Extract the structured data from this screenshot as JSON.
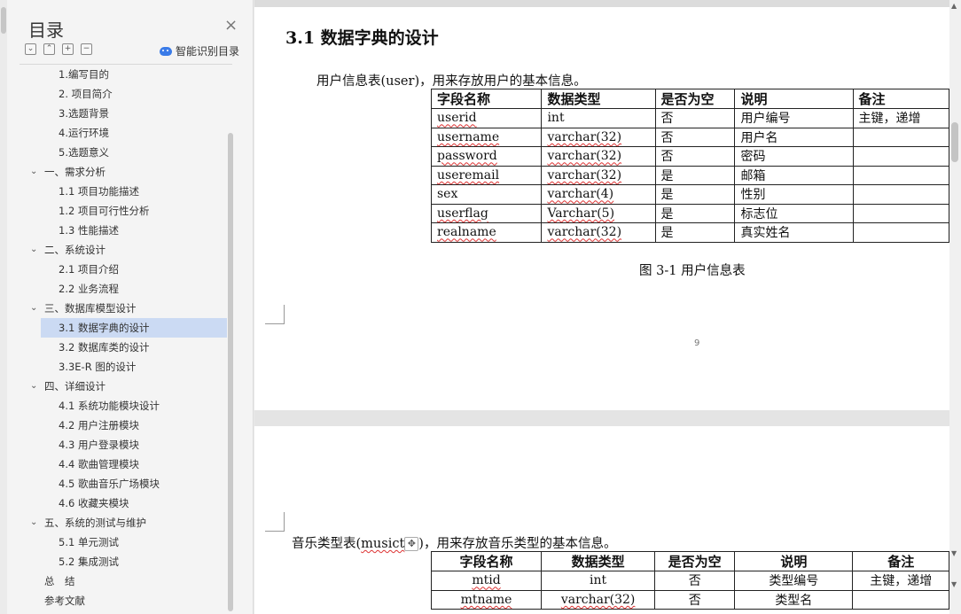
{
  "toc": {
    "title": "目录",
    "close_icon": "×",
    "tools": [
      "collapse-all-icon",
      "expand-up-icon",
      "add-icon",
      "remove-icon"
    ],
    "tool_glyphs": [
      "⌄",
      "⌃",
      "+",
      "−"
    ],
    "smart_label": "智能识别目录",
    "items": [
      {
        "label": "1.编写目的",
        "level": 2
      },
      {
        "label": "2. 项目简介",
        "level": 2
      },
      {
        "label": "3.选题背景",
        "level": 2
      },
      {
        "label": "4.运行环境",
        "level": 2
      },
      {
        "label": "5.选题意义",
        "level": 2
      },
      {
        "label": "一、需求分析",
        "level": 1,
        "expanded": true
      },
      {
        "label": "1.1 项目功能描述",
        "level": 2
      },
      {
        "label": "1.2 项目可行性分析",
        "level": 2
      },
      {
        "label": "1.3 性能描述",
        "level": 2
      },
      {
        "label": "二、系统设计",
        "level": 1,
        "expanded": true
      },
      {
        "label": "2.1 项目介绍",
        "level": 2
      },
      {
        "label": "2.2 业务流程",
        "level": 2
      },
      {
        "label": "三、数据库模型设计",
        "level": 1,
        "expanded": true
      },
      {
        "label": "3.1 数据字典的设计",
        "level": 2,
        "active": true
      },
      {
        "label": "3.2 数据库类的设计",
        "level": 2
      },
      {
        "label": "3.3E-R 图的设计",
        "level": 2
      },
      {
        "label": "四、详细设计",
        "level": 1,
        "expanded": true
      },
      {
        "label": "4.1 系统功能模块设计",
        "level": 2
      },
      {
        "label": "4.2 用户注册模块",
        "level": 2
      },
      {
        "label": "4.3 用户登录模块",
        "level": 2
      },
      {
        "label": "4.4 歌曲管理模块",
        "level": 2
      },
      {
        "label": "4.5 歌曲音乐广场模块",
        "level": 2
      },
      {
        "label": "4.6 收藏夹模块",
        "level": 2
      },
      {
        "label": "五、系统的测试与维护",
        "level": 1,
        "expanded": true
      },
      {
        "label": "5.1 单元测试",
        "level": 2
      },
      {
        "label": "5.2 集成测试",
        "level": 2
      },
      {
        "label": "总　结",
        "level": 0
      },
      {
        "label": "参考文献",
        "level": 0
      }
    ]
  },
  "document": {
    "heading": "3.1 数据字典的设计",
    "para1": "用户信息表(user)，用来存放用户的基本信息。",
    "table1": {
      "headers": [
        "字段名称",
        "数据类型",
        "是否为空",
        "说明",
        "备注"
      ],
      "rows": [
        [
          "userid",
          "int",
          "否",
          "用户编号",
          "主键，递增"
        ],
        [
          "username",
          "varchar(32)",
          "否",
          "用户名",
          ""
        ],
        [
          "password",
          "varchar(32)",
          "否",
          "密码",
          ""
        ],
        [
          "useremail",
          "varchar(32)",
          "是",
          "邮箱",
          ""
        ],
        [
          "sex",
          "varchar(4)",
          "是",
          "性别",
          ""
        ],
        [
          "userflag",
          "Varchar(5)",
          "是",
          "标志位",
          ""
        ],
        [
          "realname",
          "varchar(32)",
          "是",
          "真实姓名",
          ""
        ]
      ]
    },
    "caption1": "图 3-1 用户信息表",
    "page_number": "9",
    "para2_prefix": "音乐类型表(",
    "para2_word": "musict",
    "para2_suffix": ")，用来存放音乐类型的基本信息。",
    "move_handle_icon": "✥",
    "table2": {
      "headers": [
        "字段名称",
        "数据类型",
        "是否为空",
        "说明",
        "备注"
      ],
      "rows": [
        [
          "mtid",
          "int",
          "否",
          "类型编号",
          "主键，递增"
        ],
        [
          "mtname",
          "varchar(32)",
          "否",
          "类型名",
          ""
        ]
      ]
    }
  },
  "scrollbar": {
    "up": "▲",
    "down": "▼"
  }
}
